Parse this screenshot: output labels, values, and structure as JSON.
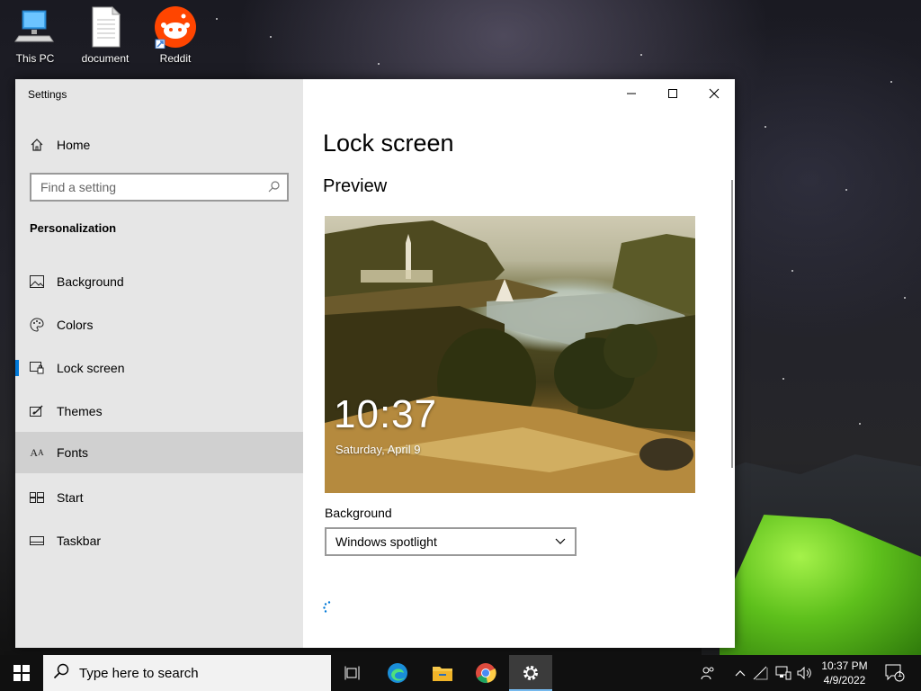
{
  "desktop": {
    "icons": [
      {
        "label": "This PC"
      },
      {
        "label": "document"
      },
      {
        "label": "Reddit"
      }
    ]
  },
  "window": {
    "title": "Settings",
    "controls": {
      "minimize": "─",
      "maximize": "☐",
      "close": "✕"
    }
  },
  "sidebar": {
    "home_label": "Home",
    "search_placeholder": "Find a setting",
    "section_label": "Personalization",
    "items": [
      {
        "label": "Background",
        "icon": "image-icon"
      },
      {
        "label": "Colors",
        "icon": "palette-icon"
      },
      {
        "label": "Lock screen",
        "icon": "lock-screen-icon",
        "selected": true
      },
      {
        "label": "Themes",
        "icon": "brush-icon"
      },
      {
        "label": "Fonts",
        "icon": "font-icon",
        "hovered": true
      },
      {
        "label": "Start",
        "icon": "start-icon"
      },
      {
        "label": "Taskbar",
        "icon": "taskbar-icon"
      }
    ]
  },
  "content": {
    "page_title": "Lock screen",
    "preview_heading": "Preview",
    "preview_time": "10:37",
    "preview_date": "Saturday, April 9",
    "background_label": "Background",
    "background_value": "Windows spotlight"
  },
  "taskbar": {
    "search_placeholder": "Type here to search",
    "clock_time": "10:37 PM",
    "clock_date": "4/9/2022",
    "notification_count": "1"
  },
  "colors": {
    "accent": "#0078d7",
    "sidebar_bg": "#e6e6e6",
    "taskbar_bg": "#101010"
  }
}
